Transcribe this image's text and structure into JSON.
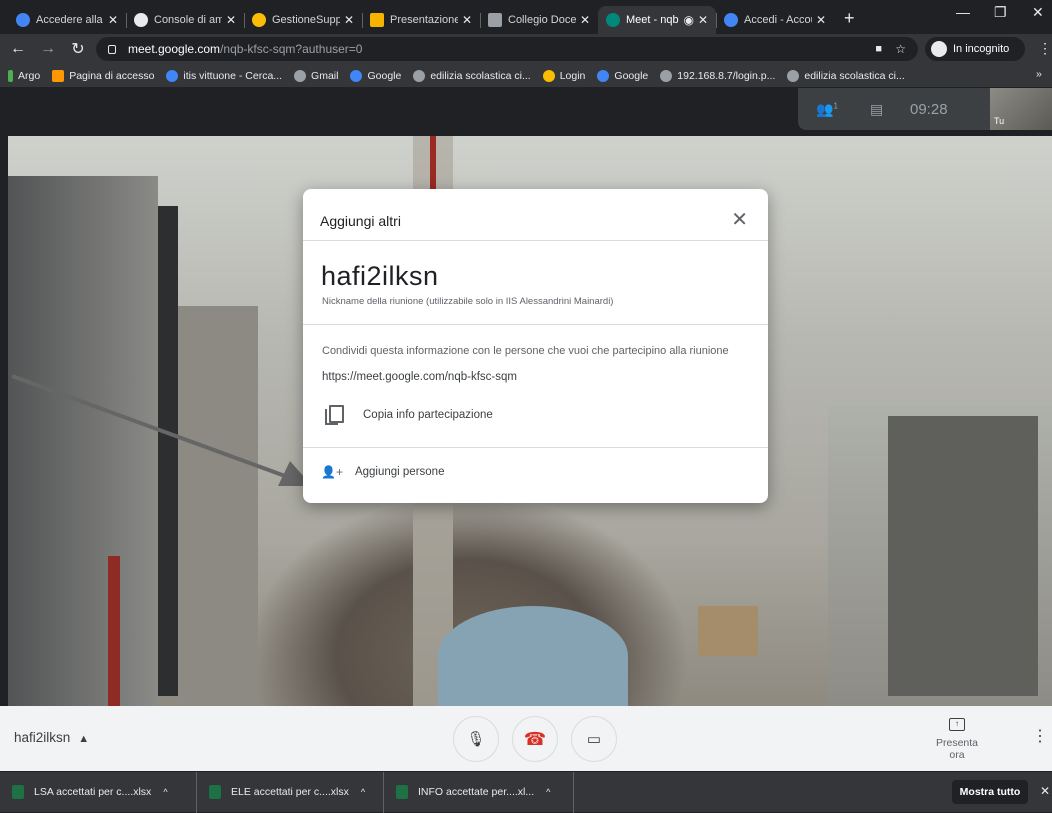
{
  "browser": {
    "tabs": [
      {
        "title": "Accedere alla Co",
        "color": "#4285f4"
      },
      {
        "title": "Console di amm",
        "color": "#e8eaed"
      },
      {
        "title": "GestioneSupple",
        "color": "#fbbc04"
      },
      {
        "title": "Presentazione s",
        "color": "#f4b400"
      },
      {
        "title": "Collegio Docent",
        "color": "#9aa0a6"
      },
      {
        "title": "Meet - nqb",
        "color": "#00897b"
      },
      {
        "title": "Accedi - Accoun",
        "color": "#4285f4"
      }
    ],
    "url_host": "meet.google.com",
    "url_path": "/nqb-kfsc-sqm?authuser=0",
    "incognito_label": "In incognito",
    "bookmarks": [
      {
        "label": "Argo",
        "color": "#4caf50"
      },
      {
        "label": "Pagina di accesso",
        "color": "#ff9800"
      },
      {
        "label": "itis vittuone - Cerca...",
        "color": "#4285f4"
      },
      {
        "label": "Gmail",
        "color": "#9aa0a6"
      },
      {
        "label": "Google",
        "color": "#4285f4"
      },
      {
        "label": "edilizia scolastica ci...",
        "color": "#9aa0a6"
      },
      {
        "label": "Login",
        "color": "#fbbc04"
      },
      {
        "label": "Google",
        "color": "#4285f4"
      },
      {
        "label": "192.168.8.7/login.p...",
        "color": "#9aa0a6"
      },
      {
        "label": "edilizia scolastica ci...",
        "color": "#9aa0a6"
      }
    ]
  },
  "meet": {
    "participants_count": "1",
    "time": "09:28",
    "self_label": "Tu",
    "meeting_name": "hafi2ilksn",
    "present_label": "Presenta ora"
  },
  "dialog": {
    "title": "Aggiungi altri",
    "nickname": "hafi2ilksn",
    "nickname_sub": "Nickname della riunione (utilizzabile solo in IIS Alessandrini Mainardi)",
    "share_text": "Condividi questa informazione con le persone che vuoi che partecipino alla riunione",
    "link": "https://meet.google.com/nqb-kfsc-sqm",
    "copy_label": "Copia info partecipazione",
    "add_label": "Aggiungi persone"
  },
  "downloads": {
    "items": [
      "LSA accettati per c....xlsx",
      "ELE accettati per c....xlsx",
      "INFO accettate per....xl..."
    ],
    "show_all": "Mostra tutto"
  }
}
